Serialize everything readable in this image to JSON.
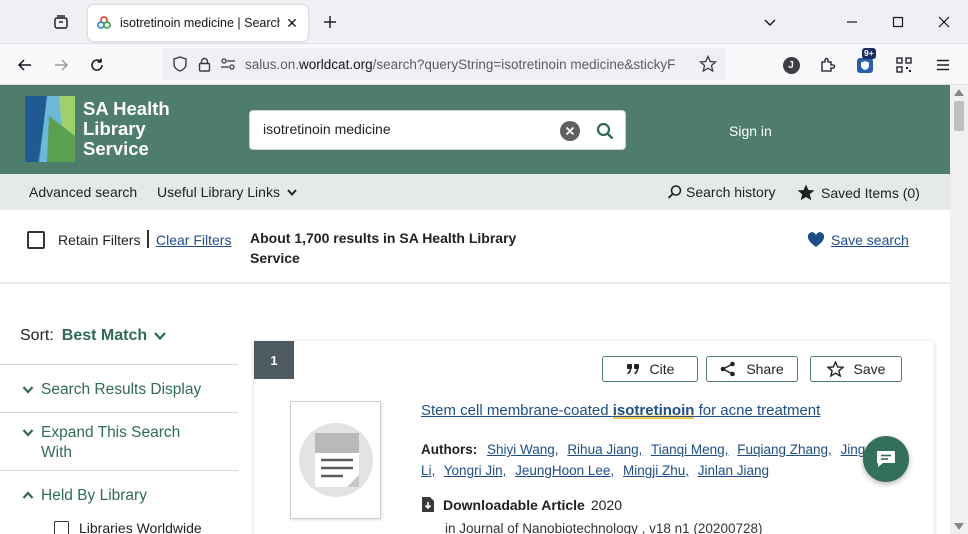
{
  "browser": {
    "tab_title": "isotretinoin medicine | Search |",
    "url_prefix": "salus.on.",
    "url_domain": "worldcat.org",
    "url_suffix": "/search?queryString=isotretinoin medicine&stickyF",
    "extension_badge": "9+",
    "account_initial": "J"
  },
  "header": {
    "logo_line1": "SA Health",
    "logo_line2": "Library",
    "logo_line3": "Service",
    "search_value": "isotretinoin medicine",
    "signin": "Sign in"
  },
  "subnav": {
    "advanced": "Advanced search",
    "useful_links": "Useful Library Links",
    "history": "Search history",
    "saved": "Saved Items (0)"
  },
  "filters": {
    "retain": "Retain Filters",
    "clear": "Clear Filters",
    "results": "About 1,700 results in SA Health Library Service",
    "save_search": "Save search"
  },
  "sidebar": {
    "sort_label": "Sort:",
    "sort_value": "Best Match",
    "items": [
      {
        "label": "Search Results Display"
      },
      {
        "label": "Expand This Search With"
      },
      {
        "label": "Held By Library"
      }
    ],
    "sub_checkbox": "Libraries Worldwide"
  },
  "result": {
    "number": "1",
    "cite": "Cite",
    "share": "Share",
    "save": "Save",
    "title_before": "Stem cell membrane-coated ",
    "title_highlight": "isotretinoin",
    "title_after": " for acne treatment",
    "authors_label": "Authors:",
    "authors": [
      "Shiyi Wang,",
      "Rihua Jiang,",
      "Tianqi Meng,",
      "Fuqiang Zhang,",
      "Jing Li,",
      "Yongri Jin,",
      "JeungHoon Lee,",
      "Mingji Zhu,",
      "Jinlan Jiang"
    ],
    "format": "Downloadable Article",
    "year": "2020",
    "journal": "in  Journal of Nanobiotechnology , v18 n1 (20200728)"
  },
  "colors": {
    "header_green": "#4e7d6c",
    "subnav_bg": "#e4ebe7",
    "link_blue": "#1d4e89",
    "accent_green": "#2f6b56"
  }
}
